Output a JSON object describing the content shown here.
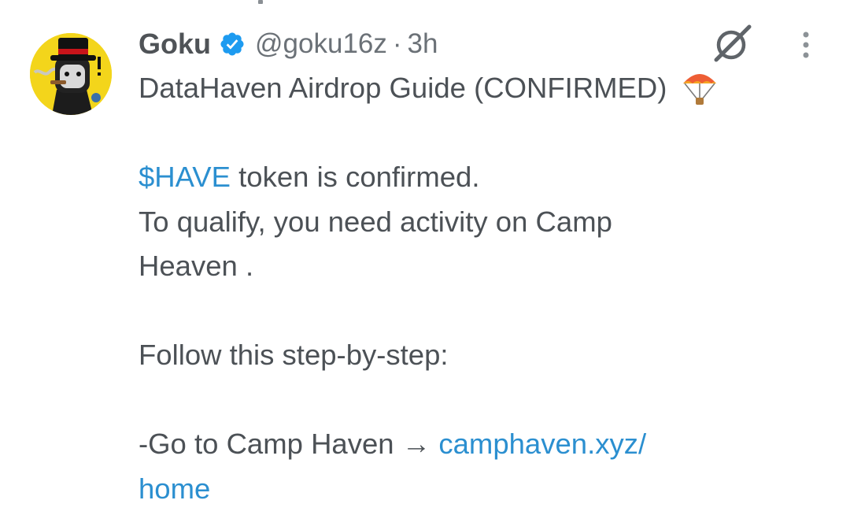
{
  "tweet": {
    "author": {
      "display_name": "Goku",
      "handle": "@goku16z",
      "verified": true,
      "avatar": "avatar-image"
    },
    "separator": "·",
    "time": "3h",
    "icons": {
      "verified": "verified-badge-icon",
      "grok": "grok-icon",
      "more": "more-vertical-icon",
      "parachute": "parachute-emoji-icon"
    },
    "body": {
      "line1": "DataHaven Airdrop Guide (CONFIRMED)",
      "line2_link": "$HAVE",
      "line2_text": " token is confirmed.",
      "line3": "To qualify, you need activity on Camp",
      "line4": "Heaven .",
      "line5": "Follow this step-by-step:",
      "line6_text": "-Go to Camp Haven → ",
      "line6_link": "camphaven.xyz/",
      "line7_link": "home"
    },
    "colors": {
      "link": "#2b8fd0",
      "verified": "#1d9bf0",
      "text": "#4c5156",
      "muted": "#6b7177",
      "avatar_bg": "#f3d51b"
    }
  }
}
